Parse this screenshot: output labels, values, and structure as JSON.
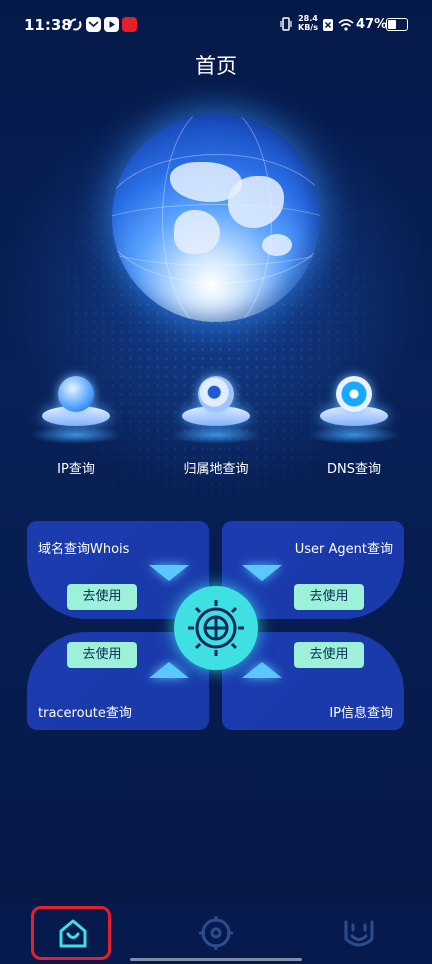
{
  "status_bar": {
    "time": "11:38",
    "net_speed": "28.4",
    "net_unit": "KB/s",
    "battery_text": "47%",
    "battery_level": 0.47,
    "notification_icons": [
      "sync-icon",
      "mail-icon",
      "video-icon",
      "news-app-icon"
    ]
  },
  "page": {
    "title": "首页"
  },
  "features": [
    {
      "label": "IP查询",
      "icon": "ip-globe-icon"
    },
    {
      "label": "归属地查询",
      "icon": "location-camera-icon"
    },
    {
      "label": "DNS查询",
      "icon": "dns-icon"
    }
  ],
  "tools": {
    "whois": {
      "title": "域名查询Whois",
      "button": "去使用"
    },
    "user_agent": {
      "title": "User Agent查询",
      "button": "去使用"
    },
    "traceroute": {
      "title": "traceroute查询",
      "button": "去使用"
    },
    "ip_info": {
      "title": "IP信息查询",
      "button": "去使用"
    }
  },
  "bottom_nav": [
    {
      "name": "home",
      "icon": "home-icon",
      "active": true
    },
    {
      "name": "tools",
      "icon": "target-icon",
      "active": false
    },
    {
      "name": "profile",
      "icon": "smiley-icon",
      "active": false
    }
  ],
  "colors": {
    "background": "#071c4f",
    "card": "#1b3bb0",
    "button": "#9df1d9",
    "accent": "#3fe0e2",
    "highlight": "#e5202a"
  }
}
